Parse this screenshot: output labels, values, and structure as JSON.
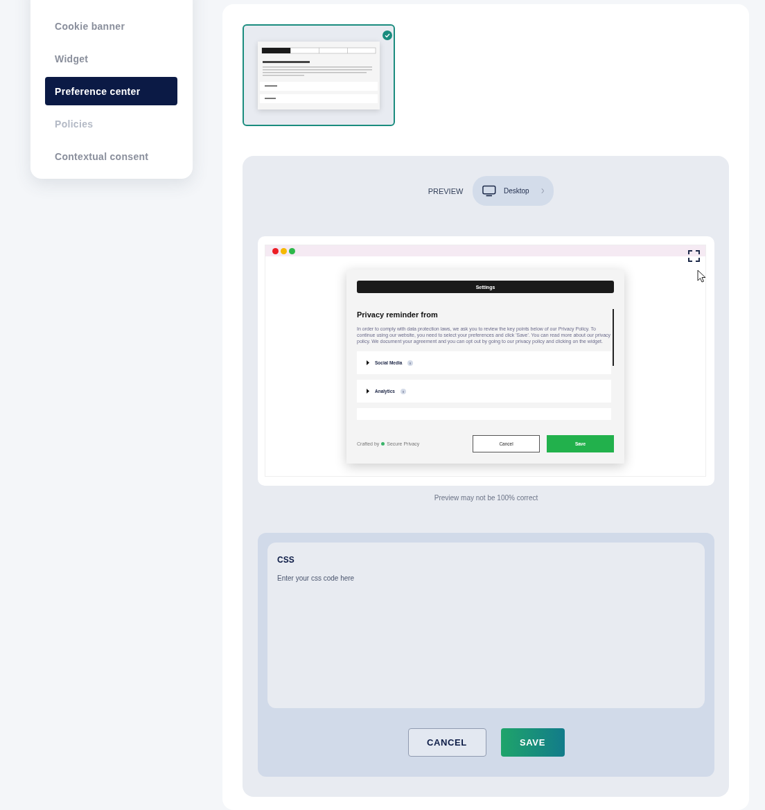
{
  "sidebar": {
    "items": [
      {
        "label": "Cookie banner",
        "selected": false,
        "disabled": false
      },
      {
        "label": "Widget",
        "selected": false,
        "disabled": false
      },
      {
        "label": "Preference center",
        "selected": true,
        "disabled": false
      },
      {
        "label": "Policies",
        "selected": false,
        "disabled": true
      },
      {
        "label": "Contextual consent",
        "selected": false,
        "disabled": false
      }
    ]
  },
  "template_thumbnail": {
    "selected": true
  },
  "preview": {
    "label": "PREVIEW",
    "device": "Desktop",
    "modal": {
      "header": "Settings",
      "title": "Privacy reminder from",
      "text": "In order to comply with data protection laws, we ask you to review the key points below of our Privacy Policy. To continue using our website, you need to select your preferences and click 'Save'. You can read more about our privacy policy. We document your agreement and you can opt out by going to our privacy policy and clicking on the widget.",
      "sections": [
        "Social Media",
        "Analytics"
      ],
      "footer_prefix": "Crafted by",
      "brand": "Secure Privacy",
      "cancel": "Cancel",
      "save": "Save"
    },
    "note": "Preview may not be 100% correct"
  },
  "css_editor": {
    "label": "CSS",
    "placeholder": "Enter your css code here"
  },
  "actions": {
    "cancel": "CANCEL",
    "save": "SAVE"
  }
}
